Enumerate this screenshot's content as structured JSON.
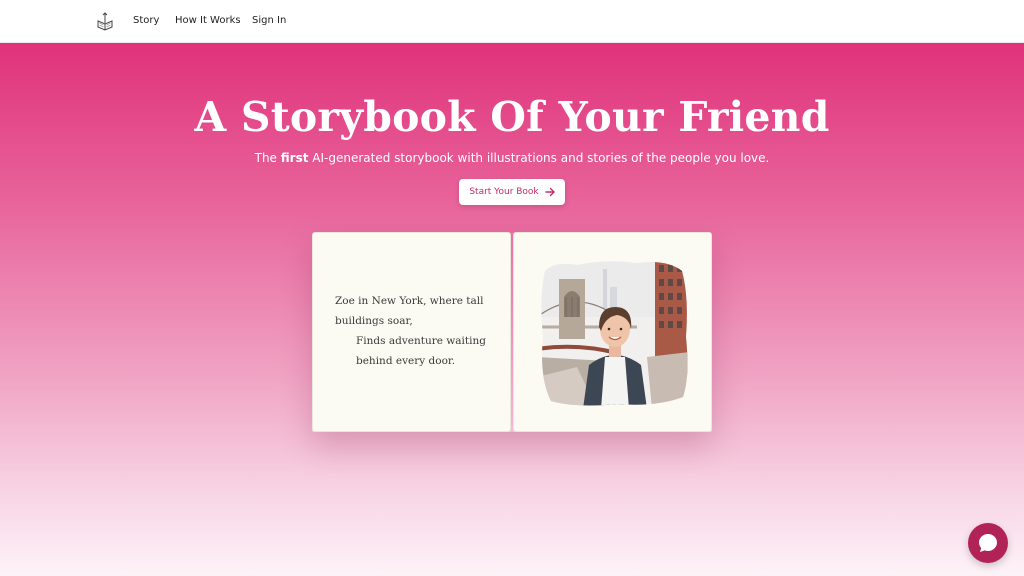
{
  "nav": {
    "links": [
      "Story",
      "How It Works",
      "Sign In"
    ]
  },
  "hero": {
    "headline_regular": "A Storybook Of Your ",
    "headline_bold": "Friend",
    "subtitle_pre": "The ",
    "subtitle_bold": "first",
    "subtitle_post": " AI-generated storybook with illustrations and stories of the people you love.",
    "cta_label": "Start Your Book"
  },
  "book": {
    "lines": [
      "Zoe in New York, where tall",
      "buildings soar,",
      "Finds adventure waiting",
      "behind every door."
    ]
  },
  "colors": {
    "brand": "#e0327a",
    "cta_text": "#c52a6b",
    "chat": "#b12256"
  },
  "icons": {
    "logo": "book-icon",
    "cta": "arrow-right-icon",
    "chat": "chat-bubble-icon"
  }
}
